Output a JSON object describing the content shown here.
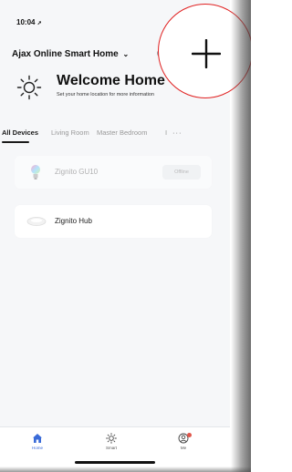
{
  "status_bar": {
    "time": "10:04"
  },
  "header": {
    "home_name": "Ajax Online Smart Home"
  },
  "welcome": {
    "title": "Welcome Home",
    "subtitle": "Set your home location for more information"
  },
  "tabs": [
    {
      "label": "All Devices",
      "active": true
    },
    {
      "label": "Living Room",
      "active": false
    },
    {
      "label": "Master Bedroom",
      "active": false
    },
    {
      "label": "I",
      "active": false
    }
  ],
  "more_tabs_icon": "more-dots-icon",
  "devices": [
    {
      "name": "Zignito GU10",
      "status": "Offline",
      "icon": "bulb-icon"
    },
    {
      "name": "Zignito Hub",
      "status": "",
      "icon": "hub-icon"
    }
  ],
  "tabbar": [
    {
      "label": "Home",
      "icon": "home-icon",
      "active": true
    },
    {
      "label": "Smart",
      "icon": "sun-icon",
      "active": false
    },
    {
      "label": "Me",
      "icon": "profile-icon",
      "active": false
    }
  ],
  "colors": {
    "accent": "#3a6bd8",
    "highlight_ring": "#e02020",
    "badge": "#e0554a"
  }
}
